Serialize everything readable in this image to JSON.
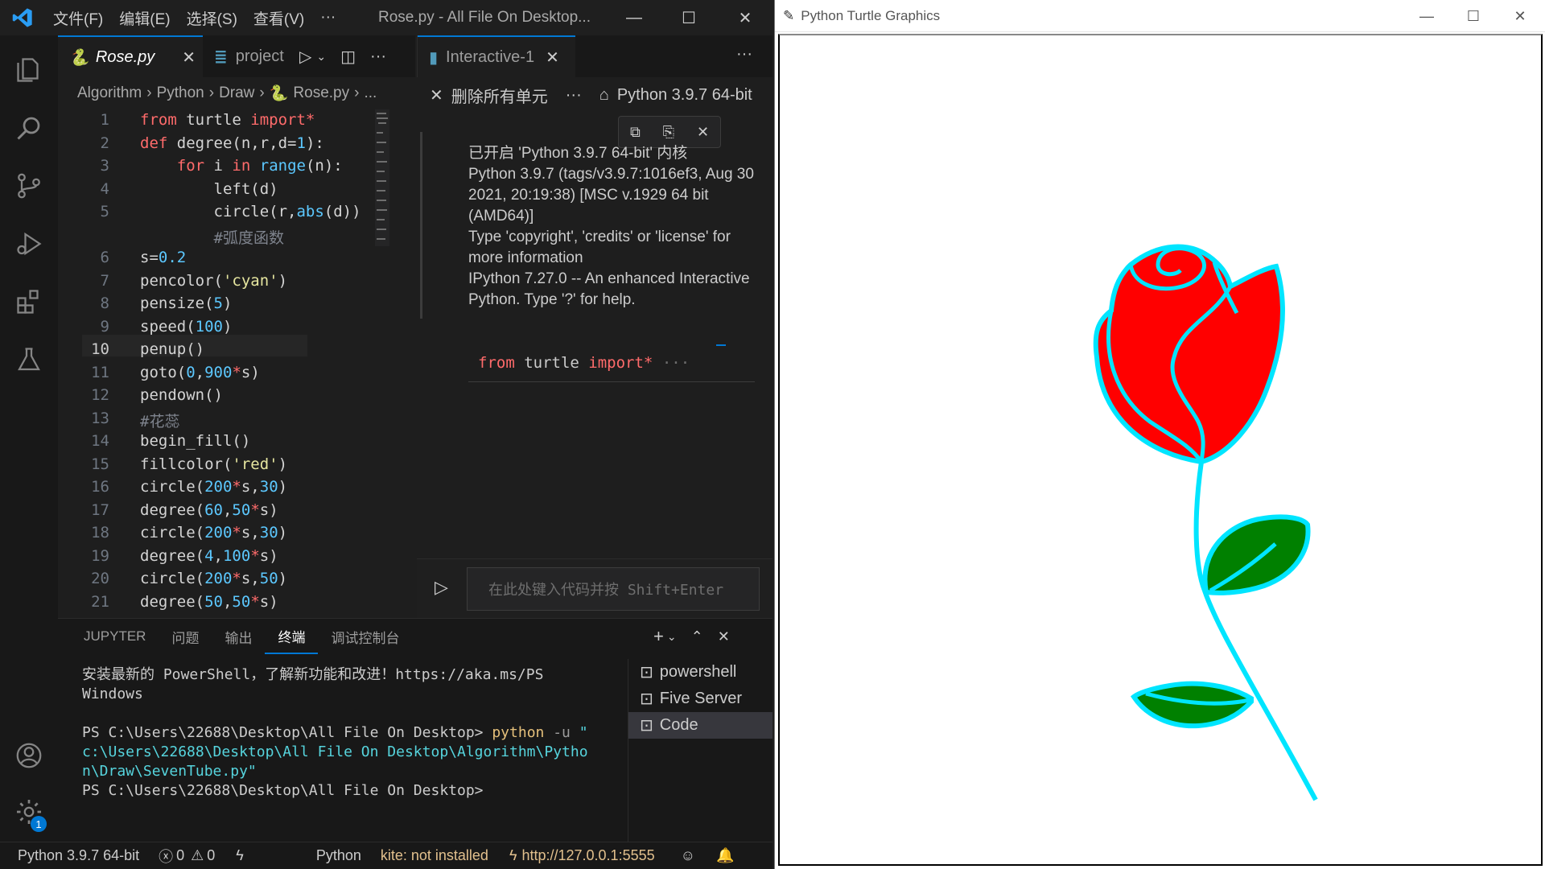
{
  "vscode": {
    "menu": [
      "文件(F)",
      "编辑(E)",
      "选择(S)",
      "查看(V)",
      "···"
    ],
    "window_title": "Rose.py - All File On Desktop...",
    "tabs_left": [
      {
        "label": "Rose.py",
        "icon": "python-icon"
      },
      {
        "label": "project",
        "icon": "css-icon"
      }
    ],
    "breadcrumb": [
      "Algorithm",
      "Python",
      "Draw",
      "Rose.py",
      "..."
    ],
    "code_lines": [
      {
        "n": "1",
        "t": "from turtle import*"
      },
      {
        "n": "2",
        "t": "def degree(n,r,d=1):"
      },
      {
        "n": "3",
        "t": "    for i in range(n):"
      },
      {
        "n": "4",
        "t": "        left(d)"
      },
      {
        "n": "5",
        "t": "        circle(r,abs(d))"
      },
      {
        "n": "",
        "t": "        #弧度函数"
      },
      {
        "n": "6",
        "t": "s=0.2"
      },
      {
        "n": "7",
        "t": "pencolor('cyan')"
      },
      {
        "n": "8",
        "t": "pensize(5)"
      },
      {
        "n": "9",
        "t": "speed(100)"
      },
      {
        "n": "10",
        "t": "penup()"
      },
      {
        "n": "11",
        "t": "goto(0,900*s)"
      },
      {
        "n": "12",
        "t": "pendown()"
      },
      {
        "n": "13",
        "t": "#花蕊"
      },
      {
        "n": "14",
        "t": "begin_fill()"
      },
      {
        "n": "15",
        "t": "fillcolor('red')"
      },
      {
        "n": "16",
        "t": "circle(200*s,30)"
      },
      {
        "n": "17",
        "t": "degree(60,50*s)"
      },
      {
        "n": "18",
        "t": "circle(200*s,30)"
      },
      {
        "n": "19",
        "t": "degree(4,100*s)"
      },
      {
        "n": "20",
        "t": "circle(200*s,50)"
      },
      {
        "n": "21",
        "t": "degree(50,50*s)"
      }
    ],
    "tab_right": "Interactive-1",
    "toolbar_right": {
      "clear_all": "删除所有单元",
      "kernel": "Python 3.9.7 64-bit"
    },
    "kernel_output": "已开启 'Python 3.9.7 64-bit' 内核\nPython 3.9.7 (tags/v3.9.7:1016ef3, Aug 30 2021, 20:19:38) [MSC v.1929 64 bit (AMD64)]\nType 'copyright', 'credits' or 'license' for more information\nIPython 7.27.0 -- An enhanced Interactive Python. Type '?' for help.",
    "cell_code": "from turtle import* ···",
    "input_placeholder": "在此处键入代码并按 Shift+Enter",
    "panel_tabs": [
      "JUPYTER",
      "问题",
      "输出",
      "终端",
      "调试控制台"
    ],
    "active_panel_tab": "终端",
    "terminal_lines": [
      "安装最新的 PowerShell，了解新功能和改进！https://aka.ms/PS",
      "Windows",
      "",
      "PS C:\\Users\\22688\\Desktop\\All File On Desktop> python -u \"",
      "c:\\Users\\22688\\Desktop\\All File On Desktop\\Algorithm\\Pytho",
      "n\\Draw\\SevenTube.py\"",
      "PS C:\\Users\\22688\\Desktop\\All File On Desktop>"
    ],
    "terminals": [
      "powershell",
      "Five Server",
      "Code"
    ],
    "status": {
      "interpreter": "Python 3.9.7 64-bit",
      "errors": "0",
      "warnings": "0",
      "language": "Python",
      "kite": "kite: not installed",
      "server": "http://127.0.0.1:5555"
    },
    "badge": "1",
    "colors": {
      "accent": "#0078d4",
      "keyword": "#ff6b6b",
      "number": "#5cc8ff",
      "string": "#e6e6a0"
    }
  },
  "turtle": {
    "title": "Python Turtle Graphics",
    "colors": {
      "stroke": "#00e5ff",
      "petal": "#ff0000",
      "leaf": "#008000"
    }
  }
}
